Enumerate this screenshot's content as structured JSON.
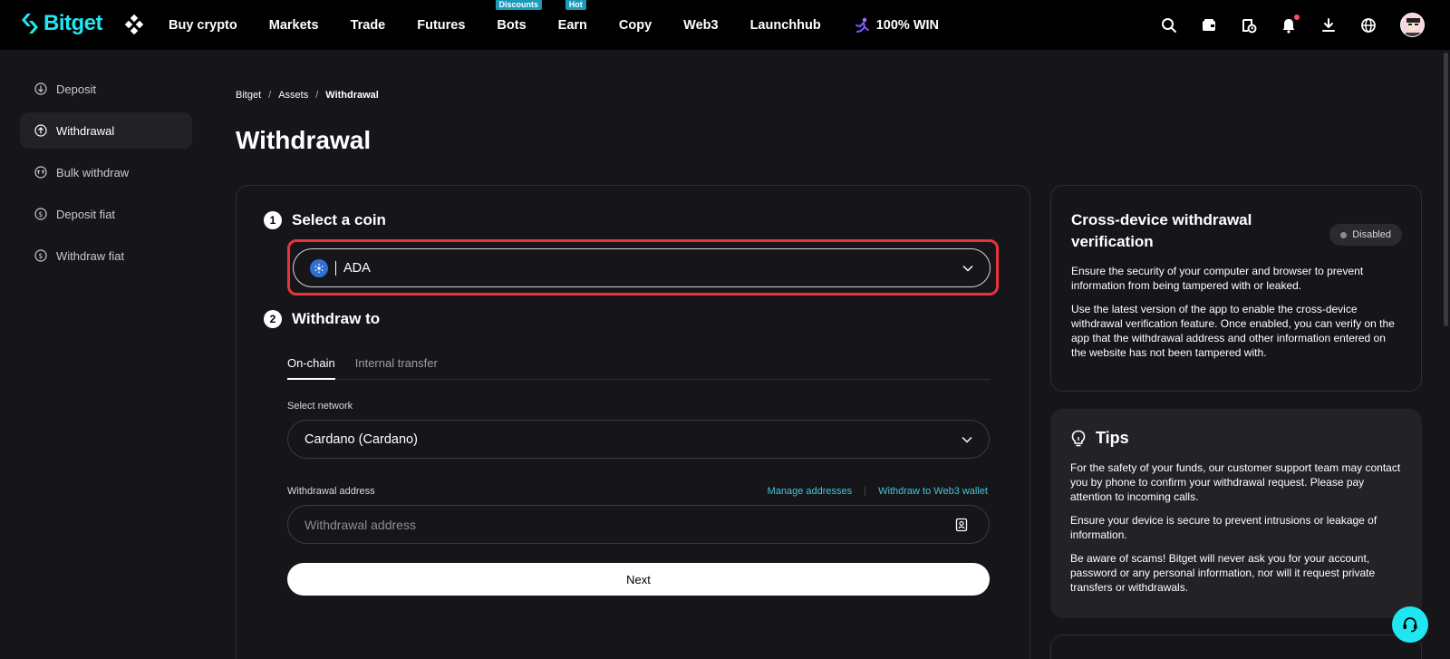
{
  "brand": {
    "name": "Bitget",
    "accent": "#1fe6f0"
  },
  "nav": {
    "items": [
      {
        "label": "Buy crypto",
        "badge": ""
      },
      {
        "label": "Markets",
        "badge": ""
      },
      {
        "label": "Trade",
        "badge": ""
      },
      {
        "label": "Futures",
        "badge": ""
      },
      {
        "label": "Bots",
        "badge": "Discounts"
      },
      {
        "label": "Earn",
        "badge": "Hot"
      },
      {
        "label": "Copy",
        "badge": ""
      },
      {
        "label": "Web3",
        "badge": ""
      },
      {
        "label": "Launchhub",
        "badge": ""
      }
    ],
    "promo": "100% WIN",
    "right_icons": [
      "search-icon",
      "wallet-icon",
      "history-icon",
      "bell-icon",
      "download-icon",
      "globe-icon",
      "avatar"
    ]
  },
  "sidebar": {
    "items": [
      {
        "label": "Deposit",
        "icon": "deposit-icon",
        "active": false
      },
      {
        "label": "Withdrawal",
        "icon": "withdrawal-icon",
        "active": true
      },
      {
        "label": "Bulk withdraw",
        "icon": "bulk-withdraw-icon",
        "active": false
      },
      {
        "label": "Deposit fiat",
        "icon": "deposit-fiat-icon",
        "active": false
      },
      {
        "label": "Withdraw fiat",
        "icon": "withdraw-fiat-icon",
        "active": false
      }
    ]
  },
  "breadcrumb": {
    "items": [
      "Bitget",
      "Assets",
      "Withdrawal"
    ],
    "separator": "/"
  },
  "page": {
    "title": "Withdrawal"
  },
  "form": {
    "step1": {
      "number": "1",
      "title": "Select a coin"
    },
    "coin": {
      "value": "ADA"
    },
    "step2": {
      "number": "2",
      "title": "Withdraw to"
    },
    "tabs": [
      {
        "label": "On-chain",
        "active": true
      },
      {
        "label": "Internal transfer",
        "active": false
      }
    ],
    "network": {
      "label": "Select network",
      "value": "Cardano (Cardano)"
    },
    "address": {
      "label": "Withdrawal address",
      "placeholder": "Withdrawal address",
      "value": "",
      "manage_link": "Manage addresses",
      "web3_link": "Withdraw to Web3 wallet"
    },
    "next_label": "Next"
  },
  "verification": {
    "title": "Cross-device withdrawal verification",
    "status": "Disabled",
    "text1": "Ensure the security of your computer and browser to prevent information from being tampered with or leaked.",
    "text2": "Use the latest version of the app to enable the cross-device withdrawal verification feature. Once enabled, you can verify on the app that the withdrawal address and other information entered on the website has not been tampered with."
  },
  "tips": {
    "title": "Tips",
    "items": [
      "For the safety of your funds, our customer support team may contact you by phone to confirm your withdrawal request. Please pay attention to incoming calls.",
      "Ensure your device is secure to prevent intrusions or leakage of information.",
      "Be aware of scams! Bitget will never ask you for your account, password or any personal information, nor will it request private transfers or withdrawals."
    ]
  },
  "colors": {
    "highlight": "#e8333a",
    "link": "#3fc6d8",
    "background": "#16161a"
  }
}
